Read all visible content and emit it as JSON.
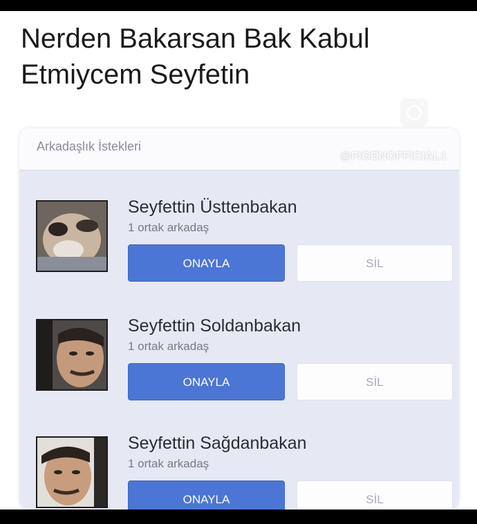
{
  "meme": {
    "title_line1": "Nerden Bakarsan Bak Kabul",
    "title_line2": "Etmiycem Seyfetin",
    "watermark": "@FIGENOFFICIAL1"
  },
  "panel": {
    "title": "Arkadaşlık İstekleri"
  },
  "requests": [
    {
      "name": "Seyfettin Üsttenbakan",
      "mutual": "1 ortak arkadaş",
      "confirm_label": "ONAYLA",
      "delete_label": "SİL"
    },
    {
      "name": "Seyfettin Soldanbakan",
      "mutual": "1 ortak arkadaş",
      "confirm_label": "ONAYLA",
      "delete_label": "SİL"
    },
    {
      "name": "Seyfettin Sağdanbakan",
      "mutual": "1 ortak arkadaş",
      "confirm_label": "ONAYLA",
      "delete_label": "SİL"
    }
  ],
  "icons": {
    "instagram": "instagram-icon"
  },
  "colors": {
    "confirm_button": "#4c76d6",
    "panel_background": "#e6e8f4"
  }
}
